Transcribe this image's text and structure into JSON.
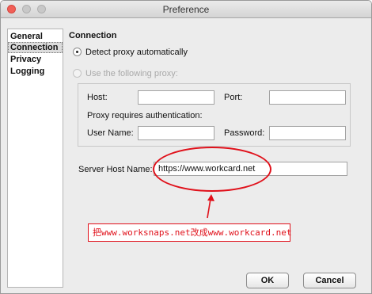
{
  "window": {
    "title": "Preference"
  },
  "sidebar": {
    "items": [
      {
        "label": "General",
        "selected": false
      },
      {
        "label": "Connection",
        "selected": true
      },
      {
        "label": "Privacy",
        "selected": false
      },
      {
        "label": "Logging",
        "selected": false
      }
    ]
  },
  "connection": {
    "title": "Connection",
    "detect_auto_label": "Detect proxy automatically",
    "detect_auto_selected": true,
    "use_proxy_label": "Use the following proxy:",
    "use_proxy_selected": false,
    "host_label": "Host:",
    "host_value": "",
    "port_label": "Port:",
    "port_value": "",
    "auth_label": "Proxy requires authentication:",
    "username_label": "User Name:",
    "username_value": "",
    "password_label": "Password:",
    "password_value": "",
    "server_host_label": "Server Host Name:",
    "server_host_value": "https://www.workcard.net"
  },
  "annotation": {
    "text": "把www.worksnaps.net改成www.workcard.net",
    "color": "#e0101a"
  },
  "buttons": {
    "ok_label": "OK",
    "cancel_label": "Cancel"
  }
}
